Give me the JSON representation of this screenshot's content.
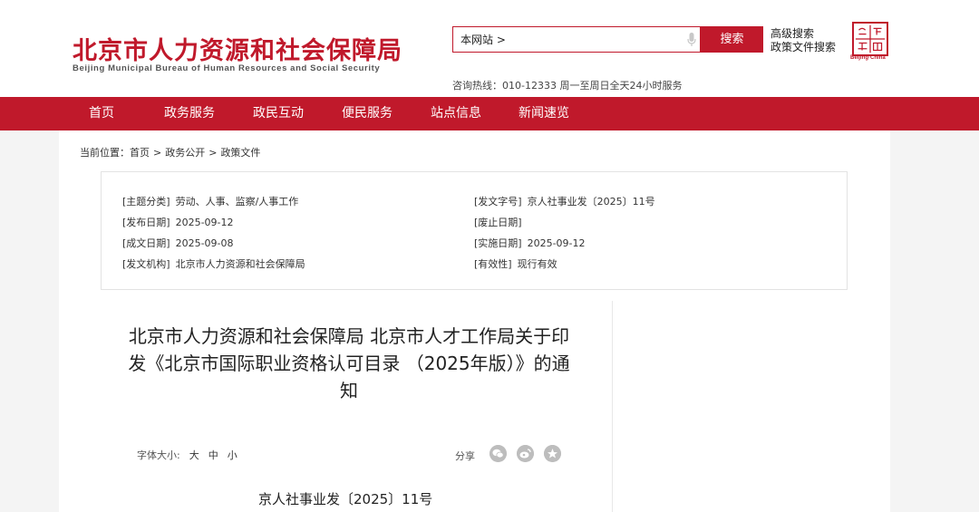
{
  "header": {
    "logo_cn": "北京市人力资源和社会保障局",
    "logo_en": "Beijing Municipal Bureau of Human Resources and Social Security",
    "search_scope": "本网站 >",
    "search_button": "搜索",
    "advanced_search": "高级搜索",
    "policy_search": "政策文件搜索",
    "hotline": "咨询热线：010-12333 周一至周日全天24小时服务",
    "seal_en": "Beijing·China",
    "accent_color": "#c0192b"
  },
  "nav": [
    {
      "label": "首页"
    },
    {
      "label": "政务服务"
    },
    {
      "label": "政民互动"
    },
    {
      "label": "便民服务"
    },
    {
      "label": "站点信息"
    },
    {
      "label": "新闻速览"
    }
  ],
  "breadcrumb": {
    "prefix": "当前位置：",
    "items": [
      "首页",
      "政务公开",
      "政策文件"
    ],
    "separator": ">"
  },
  "meta": {
    "topic": {
      "label": "[主题分类]",
      "value": "劳动、人事、监察/人事工作"
    },
    "doc_no": {
      "label": "[发文字号]",
      "value": "京人社事业发〔2025〕11号"
    },
    "publish_date": {
      "label": "[发布日期]",
      "value": "2025-09-12"
    },
    "abolish_date": {
      "label": "[废止日期]",
      "value": ""
    },
    "created_date": {
      "label": "[成文日期]",
      "value": "2025-09-08"
    },
    "effective_date": {
      "label": "[实施日期]",
      "value": "2025-09-12"
    },
    "issuer": {
      "label": "[发文机构]",
      "value": "北京市人力资源和社会保障局"
    },
    "validity": {
      "label": "[有效性]",
      "value": "现行有效"
    }
  },
  "document": {
    "title": "北京市人力资源和社会保障局 北京市人才工作局关于印发《北京市国际职业资格认可目录 （2025年版）》的通知",
    "font_size_label": "字体大小:",
    "font_sizes": [
      "大",
      "中",
      "小"
    ],
    "share_label": "分享",
    "share_icons": [
      "wechat-icon",
      "weibo-icon",
      "star-icon"
    ],
    "doc_number": "京人社事业发〔2025〕11号"
  }
}
